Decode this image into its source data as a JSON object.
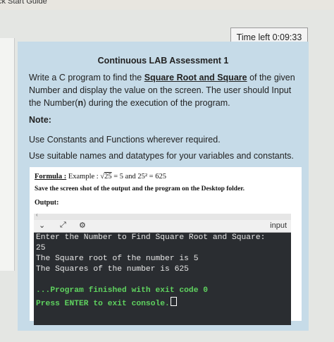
{
  "top_strip_text": "ck Start Guide",
  "timer": "Time left 0:09:33",
  "assessment": {
    "title": "Continuous LAB Assessment 1",
    "para_part1": "Write a C program to find the ",
    "para_highlight": "Square Root and Square",
    "para_part2": " of the given Number and display the value on the screen. The user should Input the Number(",
    "para_n": "n",
    "para_part3": ") during the execution of the program.",
    "note_label": "Note:",
    "note_line1": "Use Constants and Functions wherever required.",
    "note_line2": "Use suitable names and datatypes for your variables and constants."
  },
  "formula": {
    "label": "Formula :",
    "example_prefix": " Example : √",
    "sqrt_arg": "25",
    "example_rest": " = 5  and 25² = 625",
    "save_text": "Save the screen shot of the output and the program on the Desktop folder.",
    "output_label": "Output:"
  },
  "console": {
    "toolbar_input_label": "input",
    "lines": [
      "Enter the Number to Find Square Root and Square:",
      "25",
      "The Square root of the number is 5",
      "The Squares of the number is 625",
      "",
      "...Program finished with exit code 0",
      "Press ENTER to exit console."
    ]
  }
}
